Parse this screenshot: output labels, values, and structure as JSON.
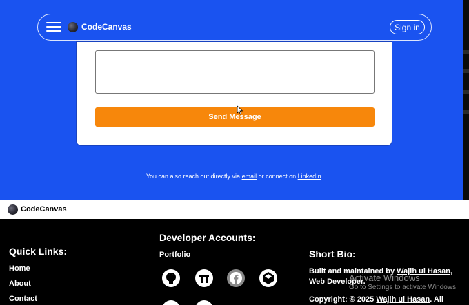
{
  "navbar": {
    "brand": "CodeCanvas",
    "signin_label": "Sign in"
  },
  "form": {
    "send_label": "Send Message"
  },
  "reach": {
    "prefix": "You can also reach out directly via ",
    "email_link": "email",
    "middle": " or connect on ",
    "linkedin_link": "LinkedIn",
    "suffix": "."
  },
  "footer_bar": {
    "brand": "CodeCanvas"
  },
  "footer": {
    "quick_links": {
      "title": "Quick Links:",
      "items": [
        "Home",
        "About",
        "Contact"
      ]
    },
    "developer": {
      "title": "Developer Accounts:",
      "portfolio": "Portfolio",
      "icons": [
        "github-icon",
        "medium-icon",
        "facebook-icon",
        "codepen-icon"
      ]
    },
    "bio": {
      "title": "Short Bio:",
      "line_prefix": "Built and maintained by ",
      "author": "Wajih ul Hasan",
      "line_suffix": ",",
      "role": "Web Developer.",
      "copyright_prefix": "Copyright: © 2025 ",
      "copyright_author": "Wajih ul Hasan",
      "copyright_suffix": ". All"
    }
  },
  "watermark": {
    "title": "Activate Windows",
    "subtitle": "Go to Settings to activate Windows."
  },
  "colors": {
    "primary_blue": "#1a53f0",
    "accent_orange": "#f7870b",
    "footer_bg": "#000000"
  }
}
